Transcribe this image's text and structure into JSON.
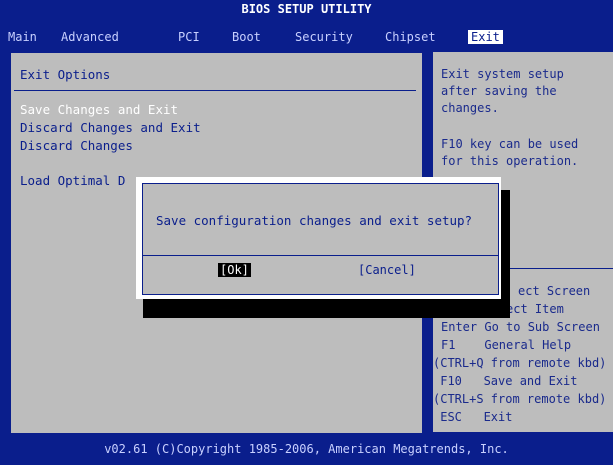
{
  "title": "BIOS SETUP UTILITY",
  "menu": {
    "items": [
      {
        "label": "Main"
      },
      {
        "label": "Advanced"
      },
      {
        "label": "PCI"
      },
      {
        "label": "Boot"
      },
      {
        "label": "Security"
      },
      {
        "label": "Chipset"
      },
      {
        "label": "Exit"
      }
    ],
    "active": "Exit"
  },
  "exit_panel": {
    "heading": "Exit Options",
    "options": [
      {
        "label": "Save Changes and Exit"
      },
      {
        "label": "Discard Changes and Exit"
      },
      {
        "label": "Discard Changes"
      },
      {
        "label": "Load Optimal D"
      }
    ]
  },
  "help": {
    "description": [
      "Exit system setup",
      "after saving the",
      "changes."
    ],
    "hint": [
      "F10 key can be used",
      "for this operation."
    ],
    "keys": [
      "ect Screen",
      "↑↓    Select Item",
      "Enter Go to Sub Screen",
      "F1    General Help",
      "(CTRL+Q from remote kbd)",
      " F10   Save and Exit",
      "(CTRL+S from remote kbd)",
      " ESC   Exit"
    ]
  },
  "dialog": {
    "message": "Save configuration changes and exit setup?",
    "ok_label": "[Ok]",
    "cancel_label": "[Cancel]"
  },
  "footer": "v02.61 (C)Copyright 1985-2006, American Megatrends, Inc.",
  "colors": {
    "background": "#0a1e8c",
    "panel": "#bdbdbd",
    "text_blue": "#0a1e8c"
  }
}
